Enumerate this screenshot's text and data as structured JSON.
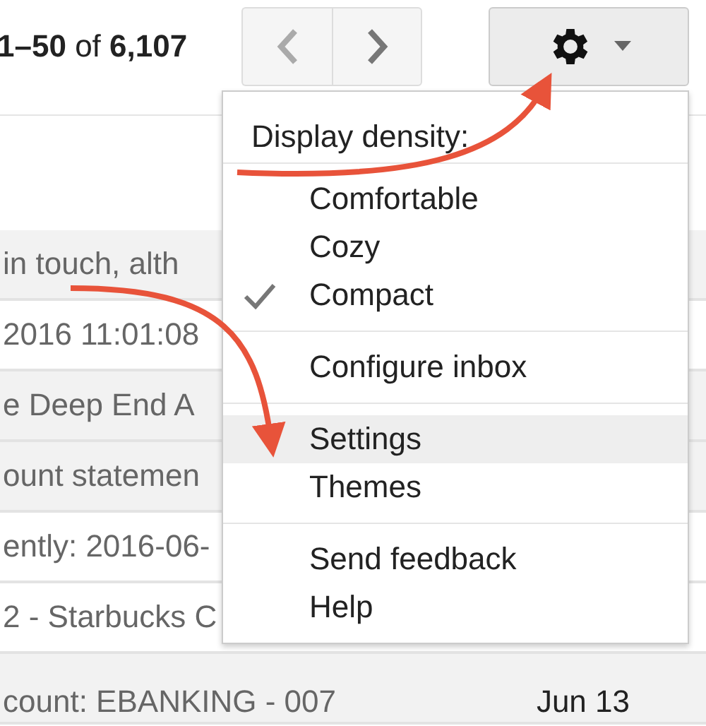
{
  "pager": {
    "range": "**1–50** of **6,107**"
  },
  "menu": {
    "header": "Display density:",
    "sections": [
      [
        {
          "label": "Comfortable",
          "checked": false,
          "selected": false
        },
        {
          "label": "Cozy",
          "checked": false,
          "selected": false
        },
        {
          "label": "Compact",
          "checked": true,
          "selected": false
        }
      ],
      [
        {
          "label": "Configure inbox",
          "checked": false,
          "selected": false
        }
      ],
      [
        {
          "label": "Settings",
          "checked": false,
          "selected": true
        },
        {
          "label": "Themes",
          "checked": false,
          "selected": false
        }
      ],
      [
        {
          "label": "Send feedback",
          "checked": false,
          "selected": false
        },
        {
          "label": "Help",
          "checked": false,
          "selected": false
        }
      ]
    ]
  },
  "rows": [
    {
      "snippet": "in touch, alth",
      "read": true
    },
    {
      "snippet": "2016 11:01:08",
      "read": false
    },
    {
      "snippet": "e Deep End A",
      "read": true
    },
    {
      "snippet": "ount statemen",
      "read": true
    },
    {
      "snippet": "ently: 2016-06-",
      "read": false
    },
    {
      "snippet": "2 - Starbucks C",
      "read": false
    },
    {
      "snippet": "count: EBANKING - 007",
      "read": true,
      "date": "Jun 13"
    }
  ]
}
